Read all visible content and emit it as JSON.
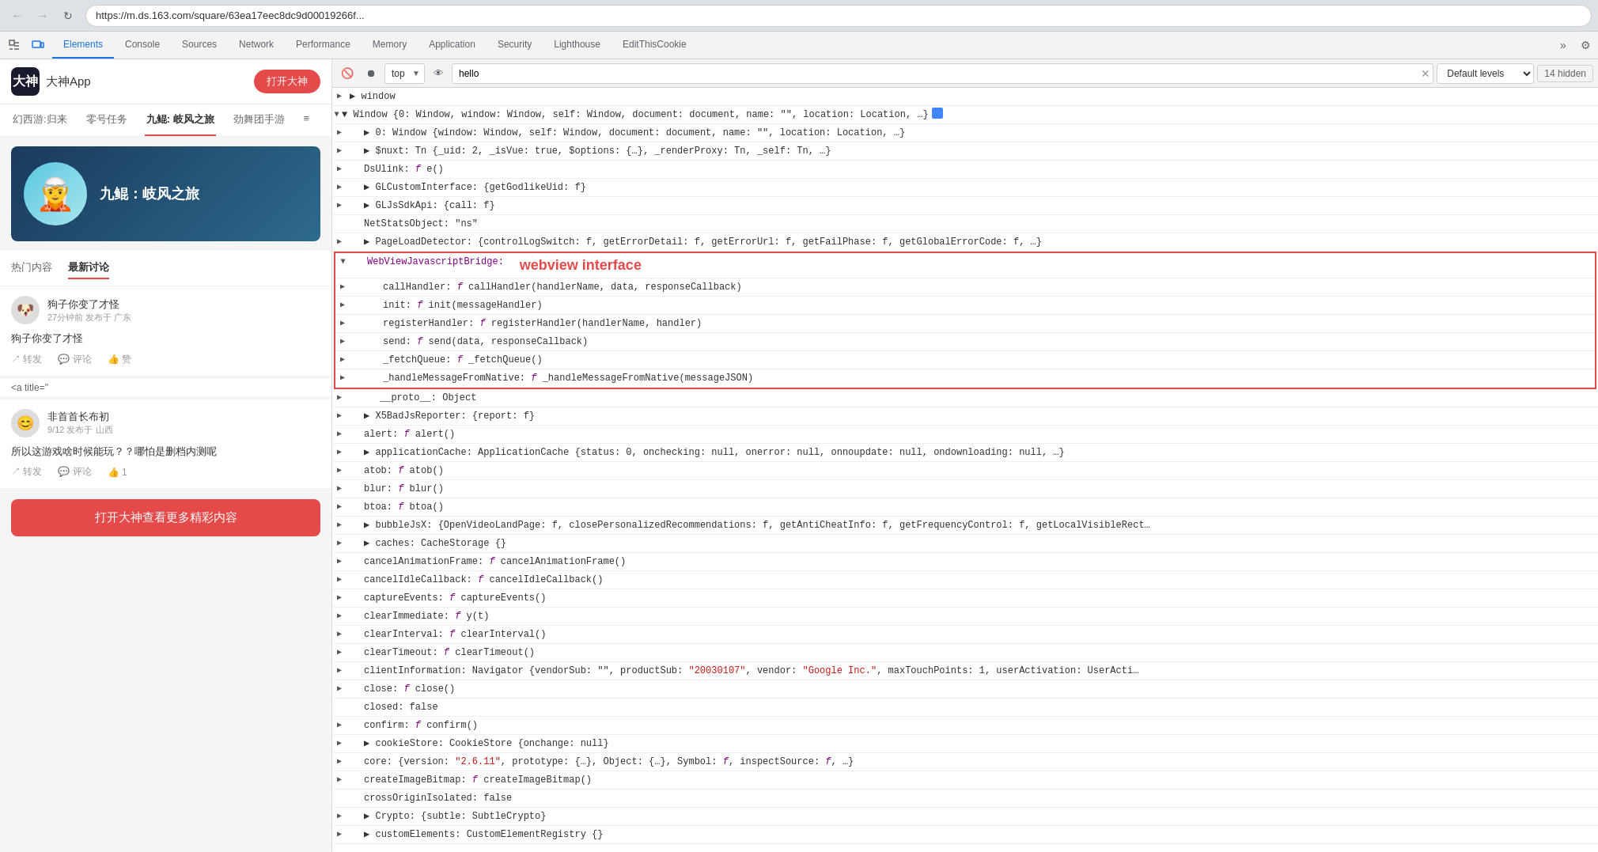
{
  "browser": {
    "back_btn": "←",
    "forward_btn": "→",
    "refresh_btn": "↻",
    "url": "https://m.ds.163.com/square/63ea17eec8dc9d00019266f..."
  },
  "devtools": {
    "tabs": [
      {
        "label": "Elements",
        "active": false
      },
      {
        "label": "Console",
        "active": true
      },
      {
        "label": "Sources",
        "active": false
      },
      {
        "label": "Network",
        "active": false
      },
      {
        "label": "Performance",
        "active": false
      },
      {
        "label": "Memory",
        "active": false
      },
      {
        "label": "Application",
        "active": false
      },
      {
        "label": "Security",
        "active": false
      },
      {
        "label": "Lighthouse",
        "active": false
      },
      {
        "label": "EditThisCookie",
        "active": false
      }
    ],
    "more_label": "»",
    "settings_label": "⚙"
  },
  "console_toolbar": {
    "clear_label": "🚫",
    "context_options": [
      "top"
    ],
    "context_selected": "top",
    "eye_label": "👁",
    "filter_placeholder": "hello",
    "filter_value": "hello",
    "log_level": "Default levels",
    "hidden_count": "14 hidden"
  },
  "webpage": {
    "logo_text": "大神",
    "app_name": "大神App",
    "open_btn_label": "打开大神",
    "nav_tabs": [
      "热门内容",
      "最新讨论"
    ],
    "nav_tab_active": "最新讨论",
    "game_tabs": [
      "幻西游:归来",
      "零号任务",
      "九鲲: 岐风之旅",
      "劲舞团手游"
    ],
    "game_title": "九鲲：岐风之旅",
    "posts": [
      {
        "avatar": "🐶",
        "author": "狗子你变了才怪",
        "meta": "27分钟前 发布于 广东",
        "content": "狗子你变了才怪",
        "actions": [
          {
            "icon": "↗",
            "label": "转发"
          },
          {
            "icon": "💬",
            "label": "评论"
          },
          {
            "icon": "👍",
            "label": "赞"
          }
        ]
      },
      {
        "avatar": "😊",
        "author": "非首首长布初",
        "meta": "9/12 发布于 山西",
        "content": "所以这游戏啥时候能玩？？哪怕是删档内测呢",
        "actions": [
          {
            "icon": "↗",
            "label": "转发"
          },
          {
            "icon": "💬",
            "label": "评论"
          },
          {
            "icon": "👍",
            "label": "1"
          }
        ]
      }
    ],
    "html_tag": "<a title=\"",
    "open_app_label": "打开大神查看更多精彩内容"
  },
  "console": {
    "window_line": "▶ window",
    "window_obj": "▼ Window {0: Window, window: Window, self: Window, document: document, name: \"\", location: Location, …}",
    "window_0": "▶ 0: Window {window: Window, self: Window, document: document, name: \"\", location: Location, …}",
    "nuxt": "▶ $nuxt: Tn {_uid: 2, _isVue: true, $options: {…}, _renderProxy: Tn, _self: Tn, …}",
    "dsulnk": "▶ DsUlink: f e()",
    "gl_custom": "▶ GLCustomInterface: {getGodlikeUid: f}",
    "gl_sdk": "▶ GLJsSdkApi: {call: f}",
    "net_stats": "  NetStatsObject: \"ns\"",
    "page_load": "▶ PageLoadDetector: {controlLogSwitch: f, getErrorDetail: f, getErrorUrl: f, getFailPhase: f, getGlobalErrorCode: f, …}",
    "webview_bridge_header": "▼ WebViewJavascriptBridge:",
    "call_handler": "▶ callHandler: f callHandler(handlerName, data, responseCallback)",
    "init": "▶ init: f init(messageHandler)",
    "register_handler": "▶ registerHandler: f registerHandler(handlerName, handler)",
    "send": "▶ send: f send(data, responseCallback)",
    "fetch_queue": "▶ _fetchQueue: f _fetchQueue()",
    "handle_msg": "▶ _handleMessageFromNative: f _handleMessageFromNative(messageJSON)",
    "webview_label": "webview interface",
    "proto": "▶ __proto__: Object",
    "x5bad": "▶ X5BadJsReporter: {report: f}",
    "alert_fn": "▶ alert: f alert()",
    "app_cache": "▶ applicationCache: ApplicationCache {status: 0, onchecking: null, onerror: null, onnoupdate: null, ondownloading: null, …}",
    "atob": "▶ atob: f atob()",
    "blur": "▶ blur: f blur()",
    "btoa": "▶ btoa: f btoa()",
    "bubble_jsx": "▶ bubbleJsX: {OpenVideoLandPage: f, closePersonalizedRecommendations: f, getAntiCheatInfo: f, getFrequencyControl: f, getLocalVisibleRect…",
    "caches": "▶ caches: CacheStorage {}",
    "cancel_animation": "▶ cancelAnimationFrame: f cancelAnimationFrame()",
    "cancel_idle": "▶ cancelIdleCallback: f cancelIdleCallback()",
    "capture_events": "▶ captureEvents: f captureEvents()",
    "clear_immediate": "▶ clearImmediate: f y(t)",
    "clear_interval": "▶ clearInterval: f clearInterval()",
    "clear_timeout": "▶ clearTimeout: f clearTimeout()",
    "client_info": "▶ clientInformation: Navigator {vendorSub: \"\", productSub: \"20030107\", vendor: \"Google Inc.\", maxTouchPoints: 1, userActivation: UserActi…",
    "close_fn": "▶ close: f close()",
    "closed": "  closed: false",
    "confirm": "▶ confirm: f confirm()",
    "cookie_store": "▶ cookieStore: CookieStore {onchange: null}",
    "core": "▶ core: {version: \"2.6.11\", prototype: {…}, Object: {…}, Symbol: f, inspectSource: f, …}",
    "create_image": "▶ createImageBitmap: f createImageBitmap()",
    "cross_origin": "  crossOriginIsolated: false",
    "crypto": "▶ Crypto: {subtle: SubtleCrypto}",
    "custom_elements": "▶ customElements: CustomElementRegistry {}"
  }
}
